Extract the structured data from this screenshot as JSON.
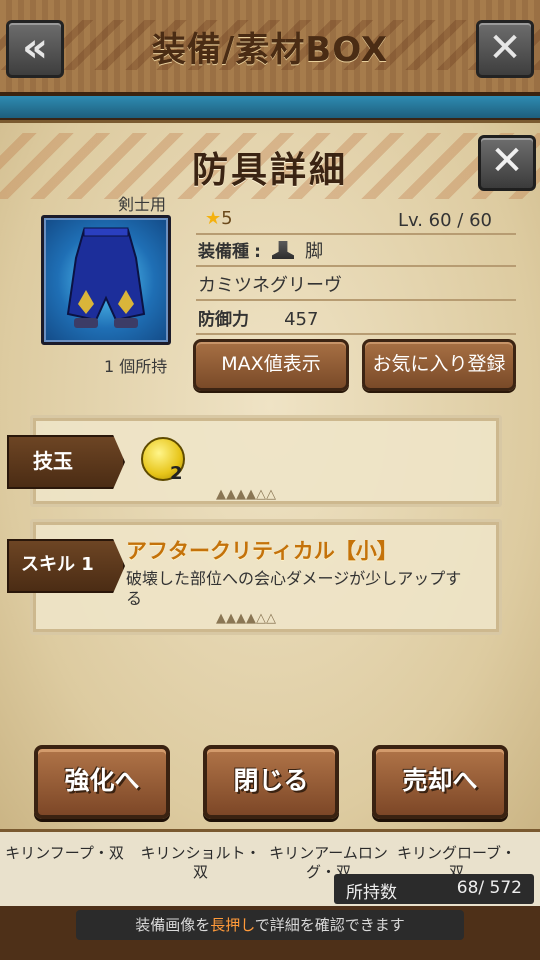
{
  "header": {
    "title": "装備/素材BOX",
    "back_glyph": "«",
    "close_glyph": "✕"
  },
  "back_list": {
    "items": [
      "キリンフープ・双",
      "キリンショルト・双",
      "キリンアームロング・双",
      "キリングローブ・双"
    ],
    "owned_label": "所持数",
    "owned_value": "68/ 572"
  },
  "footer": {
    "hint_before": "装備画像を",
    "hint_highlight": "長押し",
    "hint_after": "で詳細を確認できます"
  },
  "modal": {
    "title": "防具詳細",
    "close_glyph": "✕",
    "usage": "剣士用",
    "owned": "1 個所持",
    "rarity": "5",
    "level": "Lv. 60 / 60",
    "type_label": "装備種",
    "type_value": "脚",
    "item_name": "カミツネグリーヴ",
    "defense_label": "防御力",
    "defense_value": "457",
    "max_button": "MAX値表示",
    "favorite_button": "お気に入り登録",
    "slot_tag": "技玉",
    "slot_count": "2",
    "skill_tag": "スキル 1",
    "skill_name": "アフタークリティカル【小】",
    "skill_desc": "破壊した部位への会心ダメージが少しアップする",
    "enhance_button": "強化へ",
    "close_button": "閉じる",
    "sell_button": "売却へ"
  },
  "colors": {
    "accent_orange": "#c4720a",
    "wood": "#7d4727",
    "parchment": "#ebe0c4",
    "hint_highlight": "#ff9a3a"
  },
  "icons": [
    "back-arrow-icon",
    "close-icon",
    "star-icon",
    "leg-armor-icon",
    "gem-slot-icon"
  ]
}
